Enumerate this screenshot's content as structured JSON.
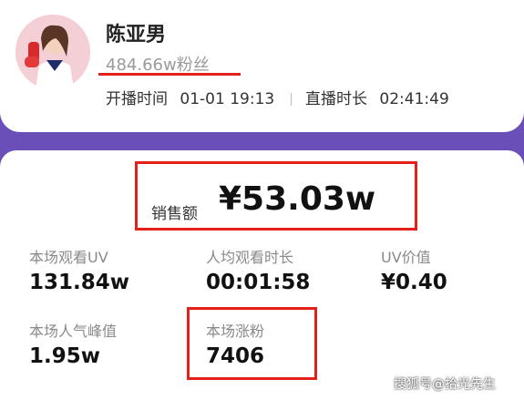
{
  "streamer": {
    "name": "陈亚男",
    "fans": "484.66w粉丝",
    "start_label": "开播时间",
    "start_value": "01-01 19:13",
    "duration_label": "直播时长",
    "duration_value": "02:41:49"
  },
  "sales": {
    "label": "销售额",
    "value": "¥53.03w"
  },
  "stats": [
    {
      "label": "本场观看UV",
      "value": "131.84w"
    },
    {
      "label": "人均观看时长",
      "value": "00:01:58"
    },
    {
      "label": "UV价值",
      "value": "¥0.40"
    },
    {
      "label": "本场人气峰值",
      "value": "1.95w"
    },
    {
      "label": "本场涨粉",
      "value": "7406"
    }
  ],
  "watermark": "搜狐号@拾光先生",
  "colors": {
    "accent_red": "#e3201b",
    "purple": "#6b4fb8"
  }
}
